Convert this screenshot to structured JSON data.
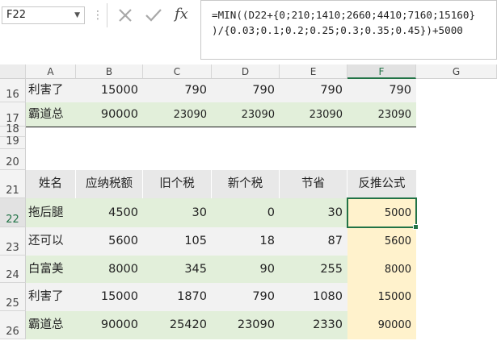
{
  "formula_bar": {
    "name_box": "F22",
    "fx_label": "fx",
    "formula_line1": "=MIN((D22+{0;210;1410;2660;4410;7160;15160}",
    "formula_line2": ")/{0.03;0.1;0.2;0.25;0.3;0.35;0.45})+5000"
  },
  "columns": [
    "A",
    "B",
    "C",
    "D",
    "E",
    "F",
    "G"
  ],
  "selected_column": "F",
  "rows": {
    "r16": "16",
    "r17": "17",
    "r18": "18",
    "r19": "19",
    "r20": "20",
    "r21": "21",
    "r22": "22",
    "r23": "23",
    "r24": "24",
    "r25": "25",
    "r26": "26"
  },
  "top_table": [
    {
      "name": "利害了",
      "b": "15000",
      "c": "790",
      "d": "790",
      "e": "790",
      "f": "790"
    },
    {
      "name": "霸道总",
      "b": "90000",
      "c": "23090",
      "d": "23090",
      "e": "23090",
      "f": "23090"
    }
  ],
  "table_headers": [
    "姓名",
    "应纳税额",
    "旧个税",
    "新个税",
    "节省",
    "反推公式"
  ],
  "table_rows": [
    {
      "name": "拖后腿",
      "taxable": "4500",
      "old": "30",
      "new": "0",
      "saving": "30",
      "formula": "5000"
    },
    {
      "name": "还可以",
      "taxable": "5600",
      "old": "105",
      "new": "18",
      "saving": "87",
      "formula": "5600"
    },
    {
      "name": "白富美",
      "taxable": "8000",
      "old": "345",
      "new": "90",
      "saving": "255",
      "formula": "8000"
    },
    {
      "name": "利害了",
      "taxable": "15000",
      "old": "1870",
      "new": "790",
      "saving": "1080",
      "formula": "15000"
    },
    {
      "name": "霸道总",
      "taxable": "90000",
      "old": "25420",
      "new": "23090",
      "saving": "2330",
      "formula": "90000"
    }
  ],
  "colors": {
    "excel_green": "#217346",
    "band_green": "#e2efda",
    "band_gray": "#f2f2f2",
    "header_gray": "#e8e8e8",
    "formula_col_yellow": "#fff2cc"
  }
}
